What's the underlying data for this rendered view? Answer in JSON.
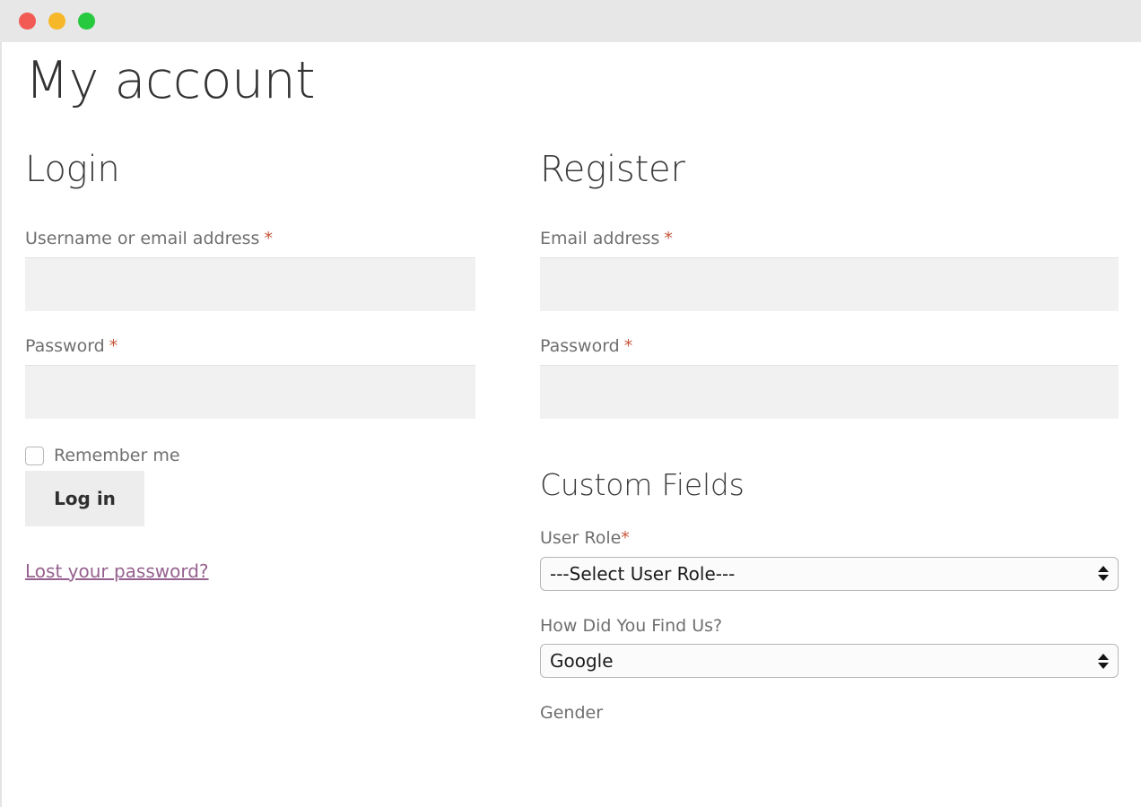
{
  "window": {
    "traffic_lights": [
      {
        "name": "close",
        "color": "#f15b54"
      },
      {
        "name": "minimize",
        "color": "#f6b828"
      },
      {
        "name": "zoom",
        "color": "#27c93f"
      }
    ]
  },
  "page": {
    "title": "My account"
  },
  "login": {
    "heading": "Login",
    "username": {
      "label": "Username or email address",
      "required_mark": "*",
      "value": "",
      "placeholder": ""
    },
    "password": {
      "label": "Password",
      "required_mark": "*",
      "value": "",
      "placeholder": ""
    },
    "remember": {
      "label": "Remember me",
      "checked": false
    },
    "submit_label": "Log in",
    "lost_password_label": "Lost your password?"
  },
  "register": {
    "heading": "Register",
    "email": {
      "label": "Email address",
      "required_mark": "*",
      "value": "",
      "placeholder": ""
    },
    "password": {
      "label": "Password",
      "required_mark": "*",
      "value": "",
      "placeholder": ""
    },
    "custom_fields": {
      "heading": "Custom Fields",
      "user_role": {
        "label": "User Role",
        "required_mark": "*",
        "selected": "---Select User Role---"
      },
      "how_did_you_find_us": {
        "label": "How Did You Find Us?",
        "selected": "Google"
      },
      "gender": {
        "label": "Gender"
      }
    }
  },
  "colors": {
    "required_asterisk": "#c8553a",
    "link": "#96618f",
    "input_background": "#f1f1f1",
    "button_background": "#ededed",
    "titlebar": "#e7e7e7",
    "heading_text": "#3b3b3b",
    "label_text": "#6f6f6f"
  }
}
